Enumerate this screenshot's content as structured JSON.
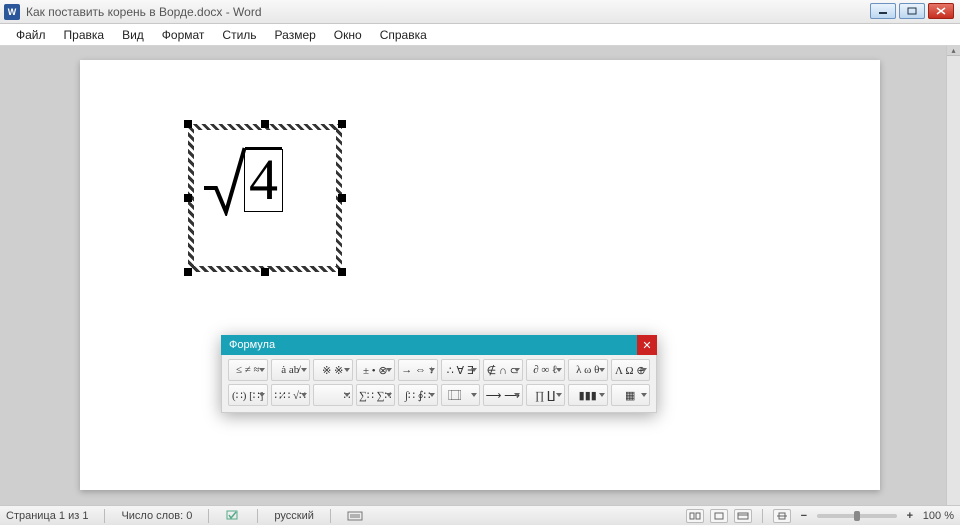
{
  "window": {
    "title": "Как поставить корень в Ворде.docx - Word",
    "app_icon_label": "W"
  },
  "menu": {
    "items": [
      "Файл",
      "Правка",
      "Вид",
      "Формат",
      "Стиль",
      "Размер",
      "Окно",
      "Справка"
    ]
  },
  "equation": {
    "radicand": "4"
  },
  "formula_panel": {
    "title": "Формула",
    "row1": [
      "≤ ≠ ≈",
      "ȧ ab̸",
      "※ ※",
      "± • ⊗",
      "→ ⇔ ↓",
      "∴ ∀ ∃",
      "∉ ∩ ⊂",
      "∂ ∞ ℓ",
      "λ ω θ",
      "Λ Ω ⊕"
    ],
    "row2": [
      "(∷) [∷]",
      "∷⁄∷  √∷",
      "∷⃞  ⃞∷",
      "∑∷ ∑∷",
      "∫∷ ∮∷",
      "⃞  ⃞",
      "⟶  ⟶",
      "∏  ∐",
      "▮▮▮",
      "▦"
    ]
  },
  "status": {
    "page": "Страница 1 из 1",
    "words": "Число слов: 0",
    "language": "русский",
    "zoom": "100 %",
    "zoom_minus": "−",
    "zoom_plus": "+"
  }
}
